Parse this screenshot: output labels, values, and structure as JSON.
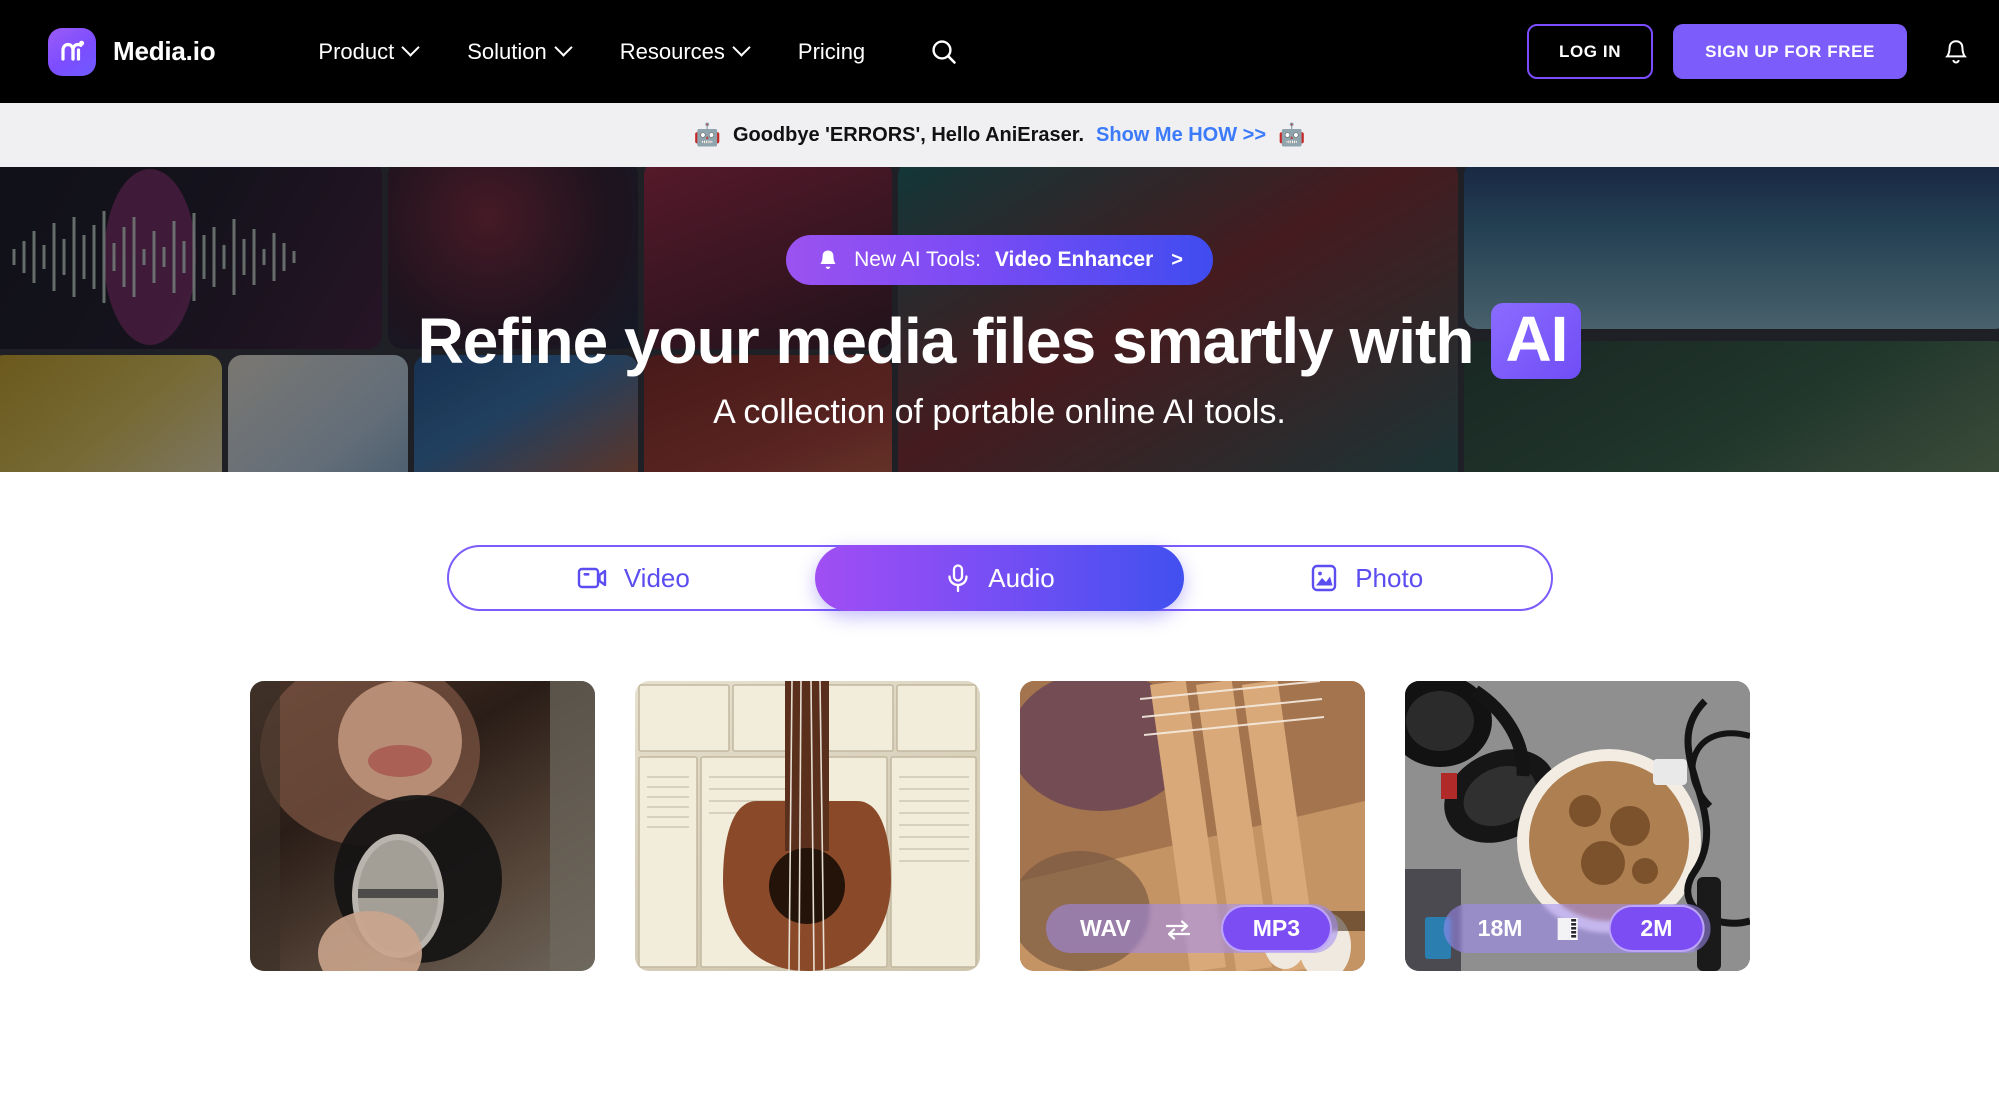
{
  "header": {
    "brand": {
      "name": "Media.io",
      "logo_icon": "media-io-logo",
      "accent": "#7c4dff"
    },
    "nav": [
      {
        "label": "Product",
        "has_dropdown": true
      },
      {
        "label": "Solution",
        "has_dropdown": true
      },
      {
        "label": "Resources",
        "has_dropdown": true
      },
      {
        "label": "Pricing",
        "has_dropdown": false
      }
    ],
    "search_icon": "search-icon",
    "login_label": "LOG IN",
    "signup_label": "SIGN UP FOR FREE",
    "bell_icon": "bell-icon"
  },
  "promo": {
    "left_emoji": "🤖",
    "right_emoji": "🤖",
    "text": "Goodbye 'ERRORS', Hello AniEraser.",
    "link": "Show Me HOW >>",
    "link_color": "#3b7bfa",
    "background": "#f0f0f3"
  },
  "hero": {
    "pill": {
      "bell_icon": "bell-icon",
      "label": "New AI Tools:",
      "target": "Video Enhancer",
      "arrow": ">"
    },
    "title_before": "Refine your media files smartly with",
    "title_chip": "AI",
    "subtitle": "A collection of portable online AI tools.",
    "chip_color": "#7c5cfa"
  },
  "tabs": {
    "items": [
      {
        "label": "Video",
        "icon": "video-camera-icon",
        "active": false
      },
      {
        "label": "Audio",
        "icon": "microphone-icon",
        "active": true
      },
      {
        "label": "Photo",
        "icon": "image-icon",
        "active": false
      }
    ],
    "accent": "#7c5cfa"
  },
  "cards": [
    {
      "name": "card-voice-recorder",
      "subject": "woman singing into microphone",
      "overlay": null
    },
    {
      "name": "card-music-books",
      "subject": "ukulele resting on open books",
      "overlay": null
    },
    {
      "name": "card-audio-converter",
      "subject": "hands playing ukulele",
      "overlay": {
        "from": "WAV",
        "mid_icon": "swap-icon",
        "to": "MP3"
      }
    },
    {
      "name": "card-audio-compressor",
      "subject": "headphones and coffee cup on desk",
      "overlay": {
        "from": "18M",
        "mid_icon": "compress-icon",
        "to": "2M"
      }
    }
  ]
}
